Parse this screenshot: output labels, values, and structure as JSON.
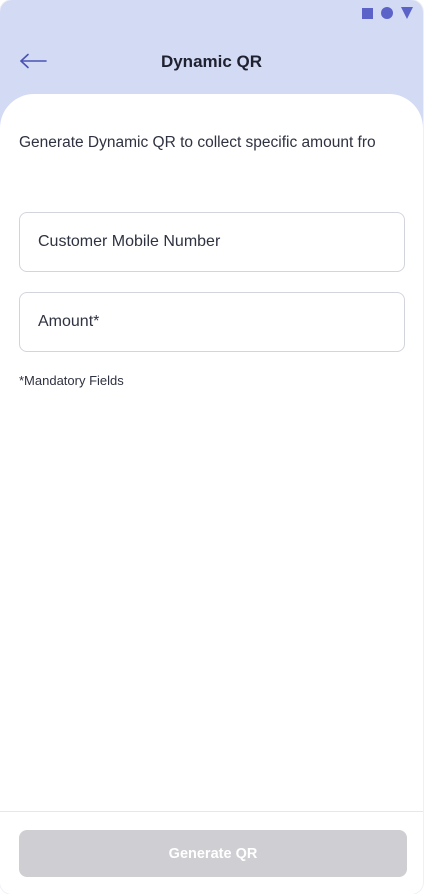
{
  "status_bar": {
    "icons": [
      "square-icon",
      "circle-icon",
      "triangle-icon"
    ],
    "icon_color": "#5b63c9"
  },
  "header": {
    "back_icon": "arrow-left-icon",
    "title": "Dynamic QR",
    "background_color": "#d3daf3"
  },
  "main": {
    "description": "Generate Dynamic QR to collect specific amount fro",
    "fields": {
      "mobile": {
        "placeholder": "Customer Mobile Number",
        "value": ""
      },
      "amount": {
        "placeholder": "Amount*",
        "value": ""
      }
    },
    "mandatory_note": "*Mandatory Fields"
  },
  "footer": {
    "generate_label": "Generate QR",
    "button_color": "#cfcfd3",
    "button_state": "disabled"
  }
}
